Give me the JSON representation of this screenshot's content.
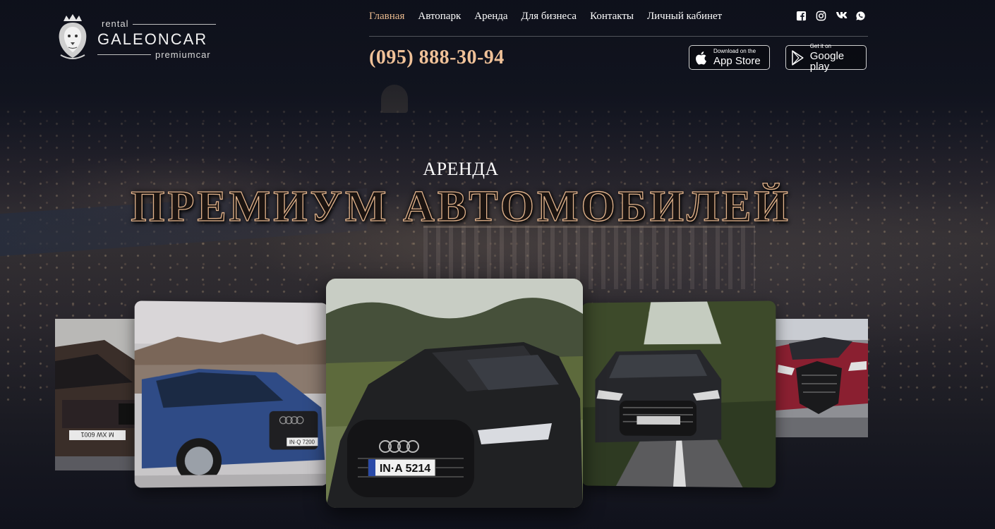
{
  "brand": {
    "rental": "rental",
    "name": "GALEONCAR",
    "sub": "premiumcar"
  },
  "nav": [
    {
      "label": "Главная",
      "active": true
    },
    {
      "label": "Автопарк",
      "active": false
    },
    {
      "label": "Аренда",
      "active": false
    },
    {
      "label": "Для бизнеса",
      "active": false
    },
    {
      "label": "Контакты",
      "active": false
    },
    {
      "label": "Личный кабинет",
      "active": false
    }
  ],
  "social": [
    "facebook-icon",
    "instagram-icon",
    "vk-icon",
    "whatsapp-icon"
  ],
  "phone": "(095) 888-30-94",
  "stores": {
    "appstore": {
      "small": "Download on the",
      "big": "App Store"
    },
    "googleplay": {
      "small": "Get it on",
      "big": "Google play"
    }
  },
  "hero": {
    "subtitle": "АРЕНДА",
    "title": "ПРЕМИУМ АВТОМОБИЛЕЙ"
  },
  "carousel": [
    {
      "plate": "M XW 6001"
    },
    {
      "plate": "IN·Q 7200"
    },
    {
      "plate": "IN·A 5214"
    },
    {
      "plate": ""
    },
    {
      "plate": ""
    }
  ],
  "colors": {
    "accent": "#e8b98e",
    "phone": "#f0c198",
    "background": "#10131c"
  }
}
